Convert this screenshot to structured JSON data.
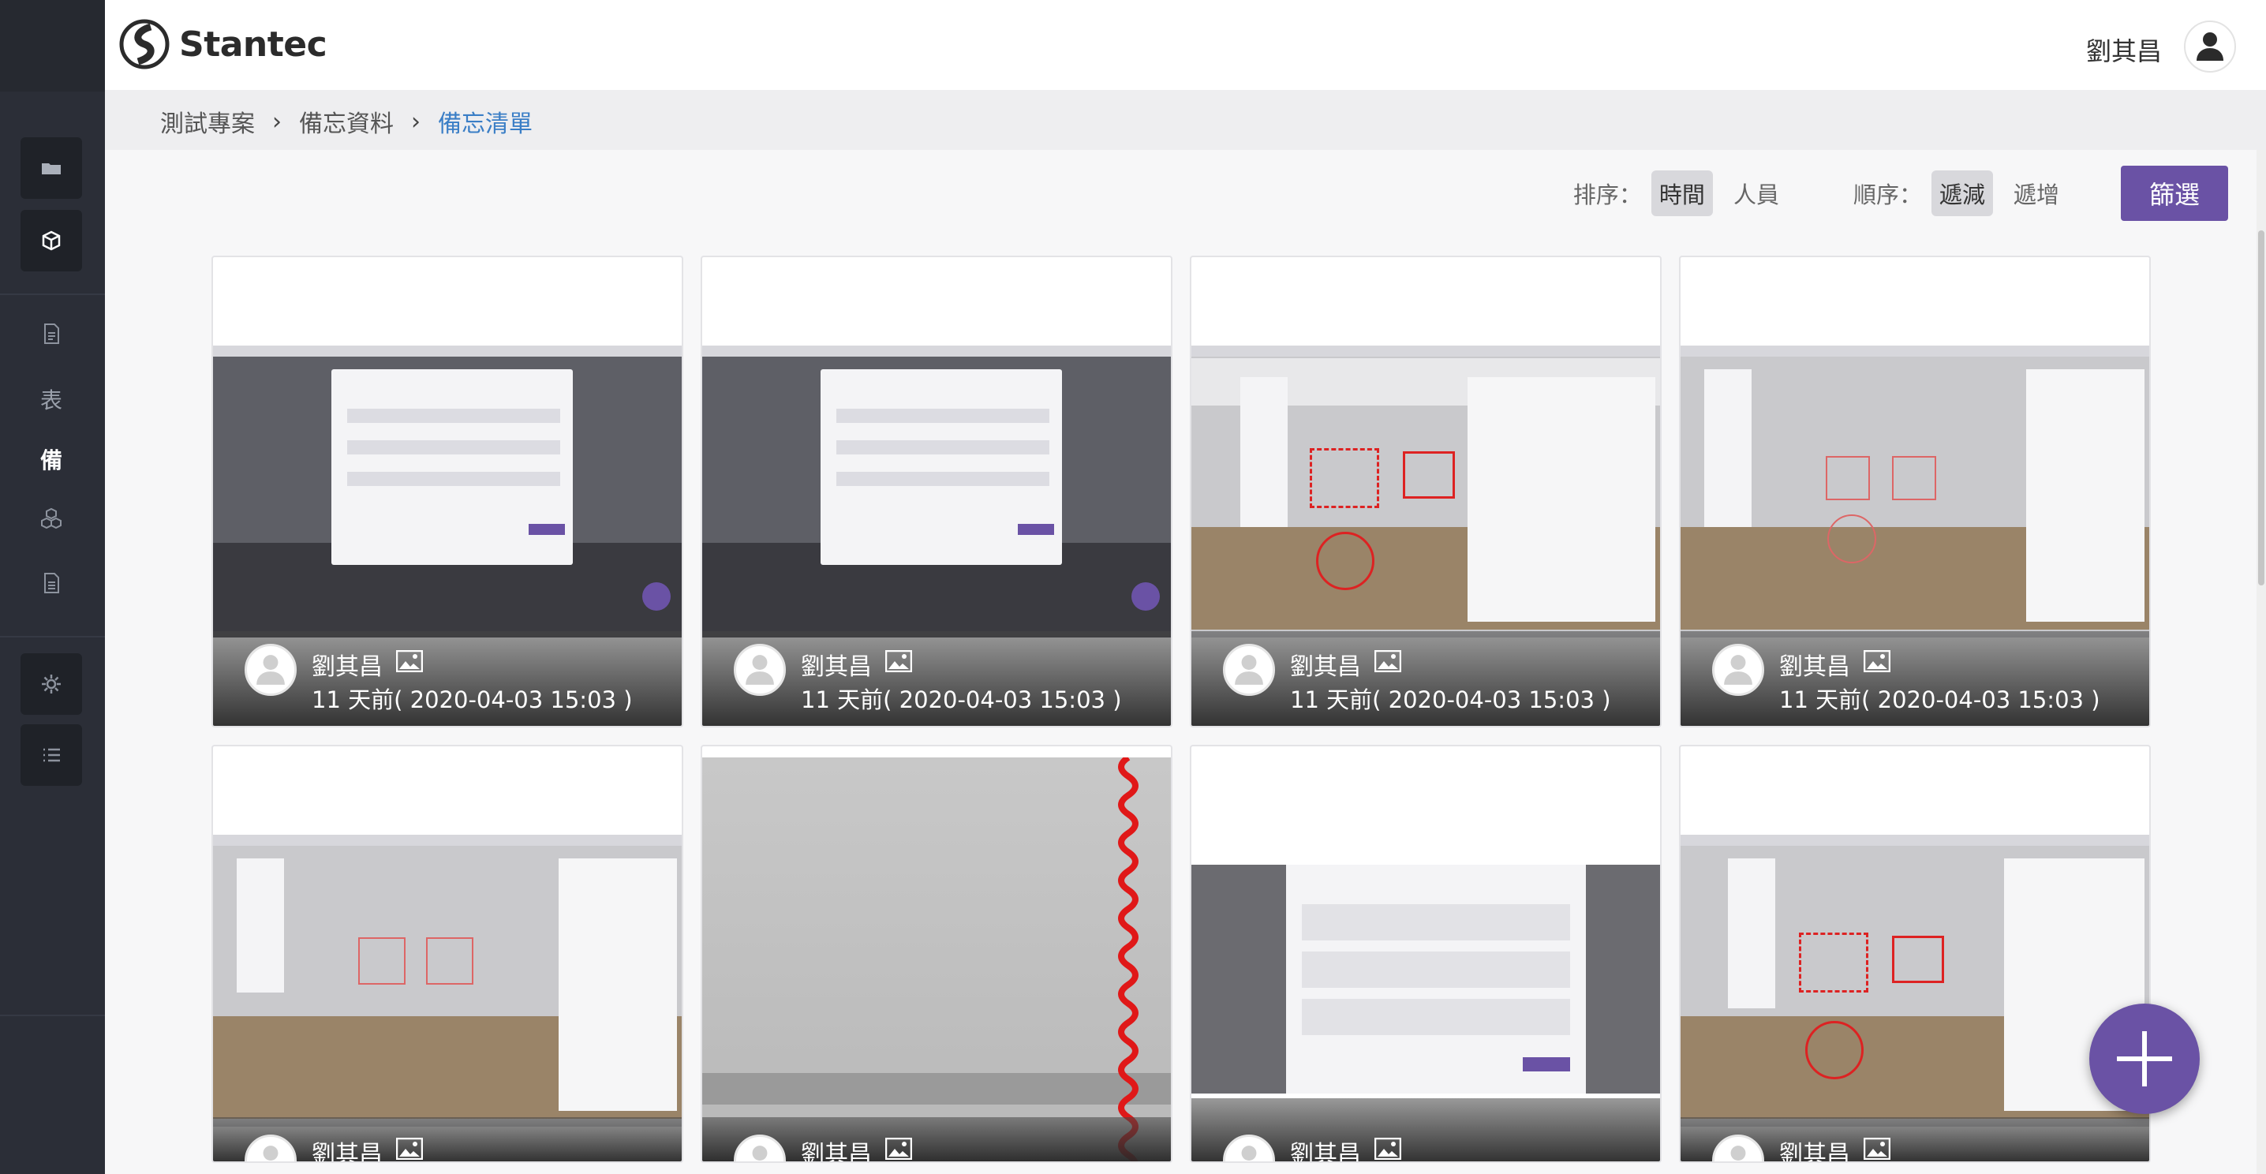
{
  "header": {
    "logo_text": "Stantec",
    "user_name": "劉其昌"
  },
  "sidebar": {
    "items": [
      {
        "icon": "folder-icon"
      },
      {
        "icon": "cube-icon"
      },
      {
        "icon": "document-icon"
      },
      {
        "label": "表"
      },
      {
        "label": "備"
      },
      {
        "icon": "cubes-icon"
      },
      {
        "icon": "file-icon"
      },
      {
        "icon": "gear-icon"
      },
      {
        "icon": "list-icon"
      }
    ]
  },
  "breadcrumb": {
    "items": [
      "測試專案",
      "備忘資料",
      "備忘清單"
    ]
  },
  "toolbar": {
    "sort_label": "排序：",
    "sort_time": "時間",
    "sort_person": "人員",
    "order_label": "順序：",
    "order_desc": "遞減",
    "order_asc": "遞增",
    "filter_button": "篩選"
  },
  "cards": [
    {
      "user": "劉其昌",
      "time": "11 天前( 2020-04-03 15:03 )"
    },
    {
      "user": "劉其昌",
      "time": "11 天前( 2020-04-03 15:03 )"
    },
    {
      "user": "劉其昌",
      "time": "11 天前( 2020-04-03 15:03 )"
    },
    {
      "user": "劉其昌",
      "time": "11 天前( 2020-04-03 15:03 )"
    },
    {
      "user": "劉其昌",
      "time": ""
    },
    {
      "user": "劉其昌",
      "time": ""
    },
    {
      "user": "劉其昌",
      "time": ""
    },
    {
      "user": "劉其昌",
      "time": ""
    }
  ],
  "colors": {
    "accent": "#6a52a5",
    "link": "#3a7ec6",
    "sidebar": "#2b2e37"
  }
}
